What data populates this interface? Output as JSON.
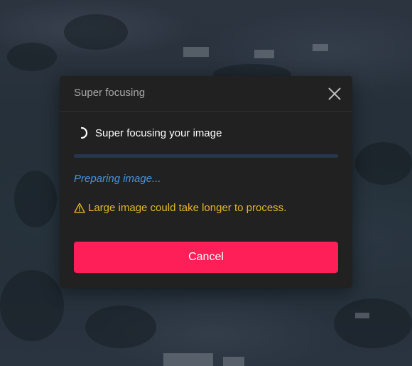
{
  "dialog": {
    "title": "Super focusing",
    "close_icon": "close-icon",
    "status": "Super focusing your image",
    "spinner_icon": "spinner-icon",
    "progress_percent": 0,
    "stage": "Preparing image...",
    "warning": {
      "icon": "warning-triangle-icon",
      "text": "Large image could take longer to process."
    },
    "cancel_label": "Cancel"
  },
  "colors": {
    "background": "#2a3340",
    "dialog": "#212121",
    "title": "#a8a8a8",
    "stage_text": "#4b93d8",
    "warning": "#e5b52f",
    "progress_track": "#27354d",
    "cancel_button": "#fe1f58"
  }
}
